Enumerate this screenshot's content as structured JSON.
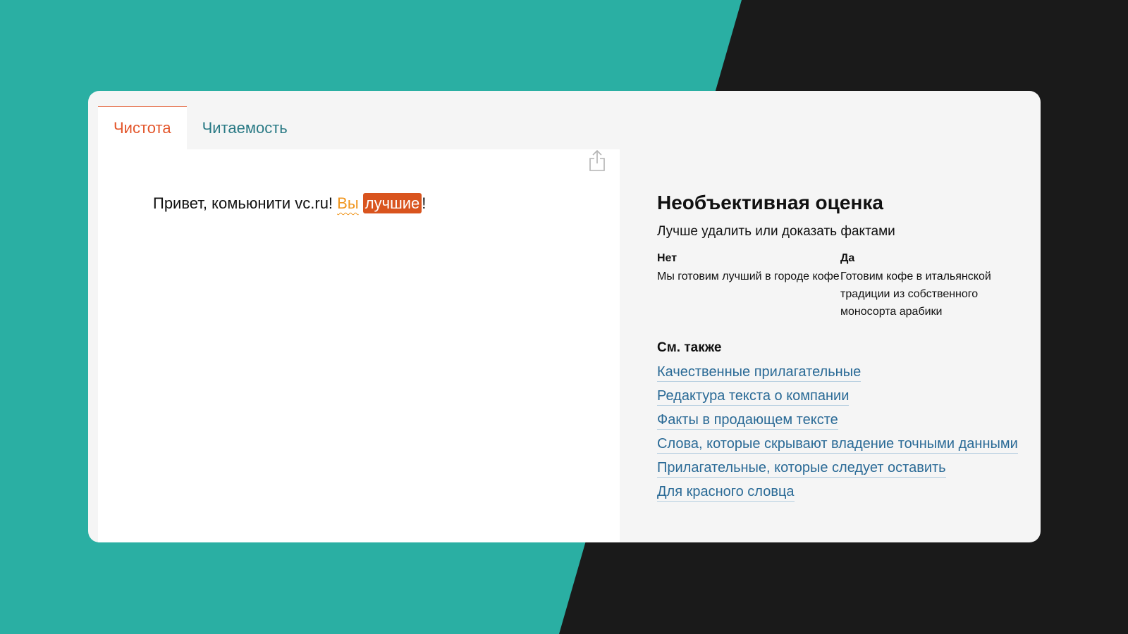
{
  "tabs": [
    {
      "label": "Чистота",
      "active": true
    },
    {
      "label": "Читаемость",
      "active": false
    }
  ],
  "editor": {
    "text_before": "Привет, комьюнити vc.ru! ",
    "highlight_soft": "Вы",
    "highlight_strong": "лучшие",
    "text_after": "!",
    "share_icon": "share-icon"
  },
  "panel": {
    "title": "Необъективная оценка",
    "subtitle": "Лучше удалить или доказать фактами",
    "examples": {
      "no_label": "Нет",
      "no_text": "Мы готовим лучший в городе кофе",
      "yes_label": "Да",
      "yes_text": "Готовим кофе в итальянской традиции из собственного моносорта арабики"
    },
    "see_also_label": "См. также",
    "links": [
      "Качественные прилагательные",
      "Редактура текста о компании",
      "Факты в продающем тексте",
      "Слова, которые скрывают владение точными данными",
      "Прилагательные, которые следует оставить",
      "Для красного словца"
    ]
  },
  "colors": {
    "background_teal": "#2aafa3",
    "background_dark": "#1a1a1a",
    "accent_orange": "#e3552a",
    "highlight_orange": "#d9541e",
    "soft_orange": "#f0961e",
    "link_blue": "#2a6a96",
    "tab_teal": "#2a7a85"
  }
}
